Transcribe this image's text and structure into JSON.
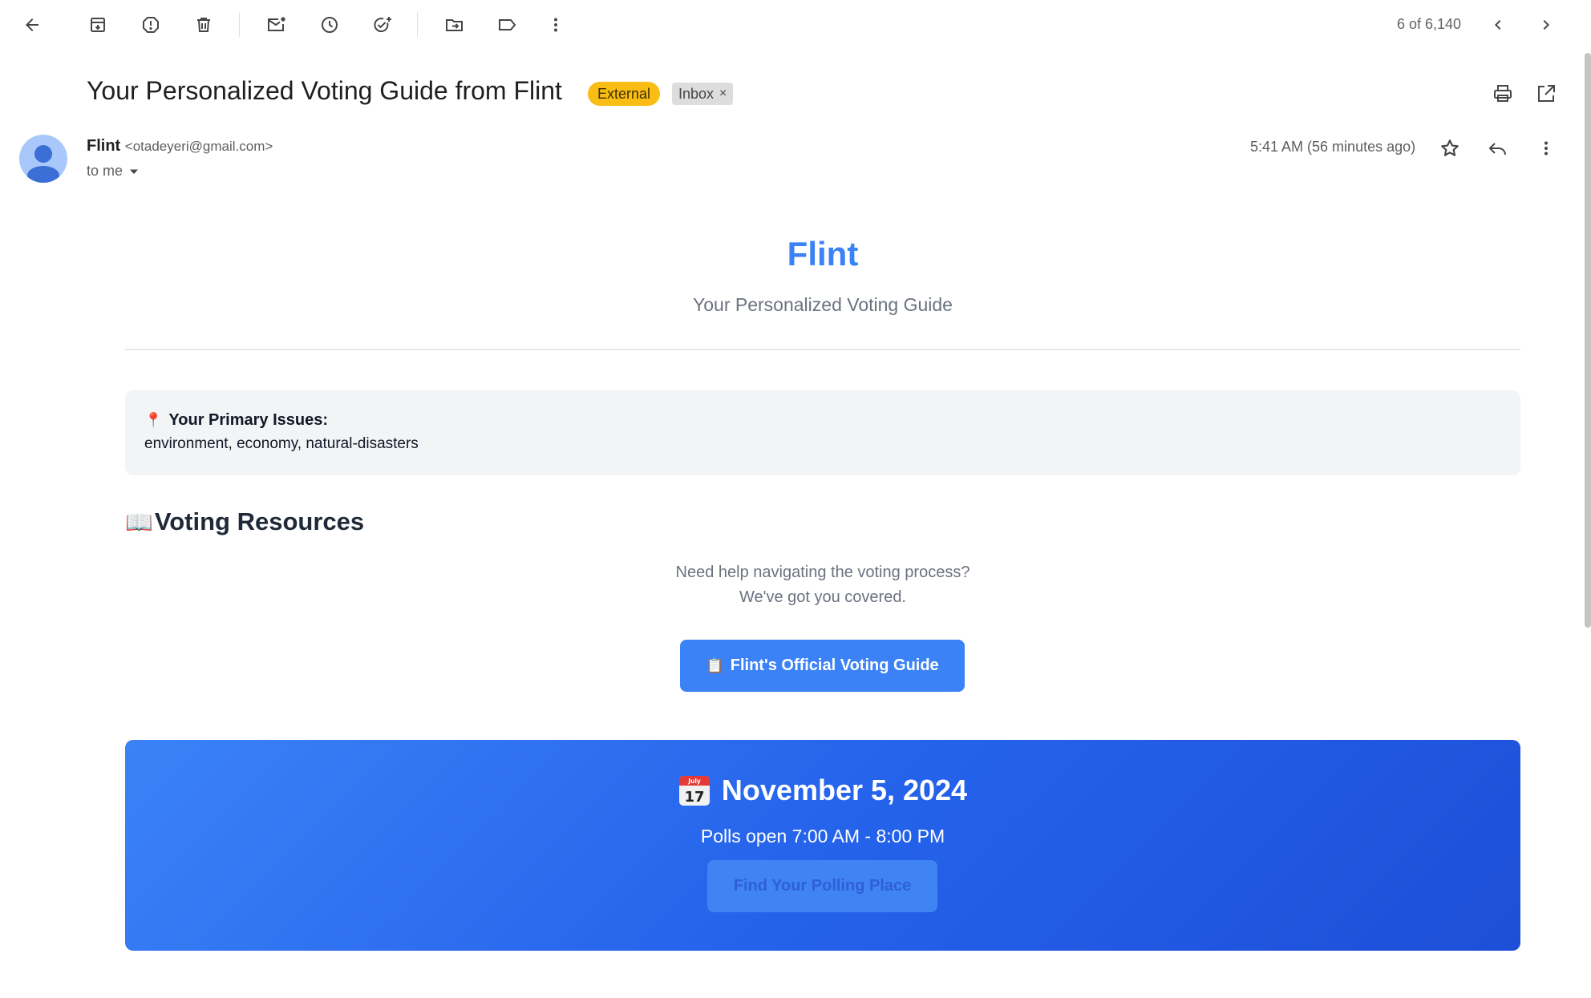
{
  "toolbar": {
    "icons": [
      "back-arrow-icon",
      "archive-icon",
      "report-spam-icon",
      "delete-icon",
      "mark-unread-icon",
      "snooze-icon",
      "add-task-icon",
      "move-to-icon",
      "label-icon",
      "more-vertical-icon"
    ],
    "pager": "6 of 6,140"
  },
  "email": {
    "subject": "Your Personalized Voting Guide from Flint",
    "badges": {
      "external": "External",
      "inbox": "Inbox",
      "inbox_remove": "×"
    },
    "sender": {
      "name": "Flint",
      "email": "<otadeyeri@gmail.com>",
      "to": "to me",
      "time": "5:41 AM (56 minutes ago)"
    }
  },
  "body": {
    "brand": "Flint",
    "tagline": "Your Personalized Voting Guide",
    "issues": {
      "icon": "📍",
      "title": "Your Primary Issues:",
      "list": "environment, economy, natural-disasters"
    },
    "resources": {
      "icon": "📖",
      "heading": "Voting Resources",
      "sub1": "Need help navigating the voting process?",
      "sub2": "We've got you covered.",
      "button_icon": "📋",
      "button": "Flint's Official Voting Guide"
    },
    "election": {
      "date": "November 5, 2024",
      "cal_month": "July",
      "cal_day": "17",
      "polls": "Polls open 7:00 AM - 8:00 PM",
      "button": "Find Your Polling Place"
    }
  },
  "colors": {
    "accent": "#3b82f6",
    "external_badge": "#f9bd14",
    "banner_start": "#3b82f6",
    "banner_end": "#1d4ed8"
  }
}
